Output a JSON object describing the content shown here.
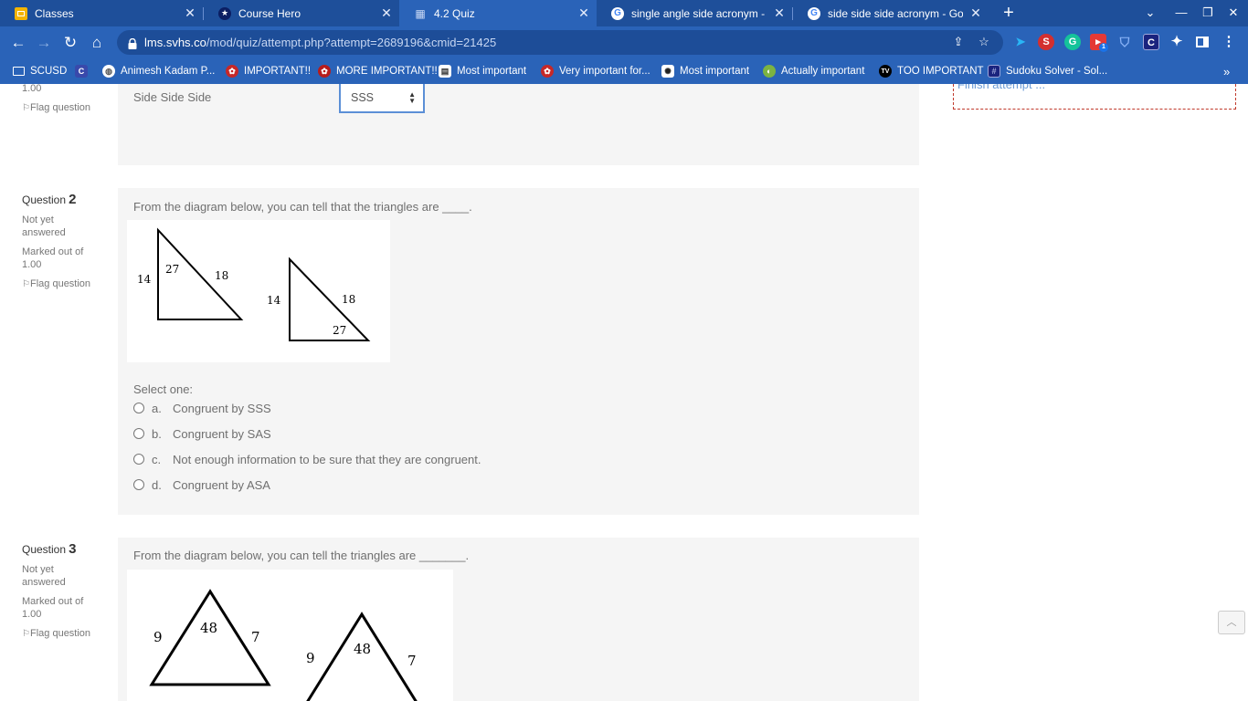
{
  "browser": {
    "tabs": [
      {
        "title": "Classes",
        "icon": "google-classroom-icon"
      },
      {
        "title": "Course Hero",
        "icon": "coursehero-icon"
      },
      {
        "title": "4.2 Quiz",
        "icon": "moodle-icon"
      },
      {
        "title": "single angle side acronym - Goo",
        "icon": "google-icon"
      },
      {
        "title": "side side side acronym - Google",
        "icon": "google-icon"
      }
    ],
    "url_host": "lms.svhs.co",
    "url_path": "/mod/quiz/attempt.php?attempt=2689196&cmid=21425",
    "bookmarks": [
      "SCUSD",
      "Animesh Kadam P...",
      "IMPORTANT!!",
      "MORE IMPORTANT!!",
      "Most important",
      "Very important for...",
      "Most important",
      "Actually important",
      "TOO IMPORTANT",
      "Sudoku Solver - Sol..."
    ],
    "extension_badge": "1"
  },
  "quiz": {
    "q1": {
      "mark_tail": "1.00",
      "flag_label": "Flag question",
      "prompt": "Side Side Side",
      "selected": "SSS"
    },
    "q2": {
      "label": "Question",
      "number": "2",
      "status": "Not yet answered",
      "marked": "Marked out of 1.00",
      "flag_label": "Flag question",
      "text": "From the diagram below, you can tell that the triangles are ____.",
      "select_one": "Select one:",
      "diagram_labels": {
        "t1_side_a": "14",
        "t1_angle": "27",
        "t1_hyp": "18",
        "t2_side_a": "14",
        "t2_hyp": "18",
        "t2_angle": "27"
      },
      "options": [
        {
          "letter": "a.",
          "text": "Congruent by SSS"
        },
        {
          "letter": "b.",
          "text": "Congruent by SAS"
        },
        {
          "letter": "c.",
          "text": "Not enough information to be sure that they are congruent."
        },
        {
          "letter": "d.",
          "text": "Congruent by ASA"
        }
      ]
    },
    "q3": {
      "label": "Question",
      "number": "3",
      "status": "Not yet answered",
      "marked": "Marked out of 1.00",
      "flag_label": "Flag question",
      "text": "From the diagram below, you can tell the triangles are _______.",
      "diagram_labels": {
        "t1_left": "9",
        "t1_top": "48",
        "t1_right": "7",
        "t2_left": "9",
        "t2_top": "48",
        "t2_right": "7"
      }
    },
    "finish_attempt": "Finish attempt ..."
  }
}
